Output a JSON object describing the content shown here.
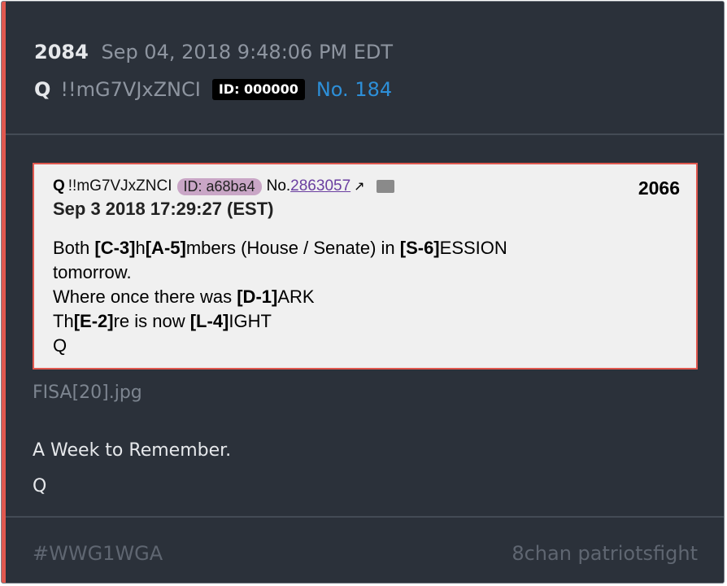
{
  "header": {
    "post_number": "2084",
    "date": "Sep 04, 2018 9:48:06 PM EDT",
    "author": "Q",
    "tripcode": "!!mG7VJxZNCI",
    "id_badge": "ID: 000000",
    "post_link": "No. 184"
  },
  "quoted_image": {
    "author": "Q",
    "tripcode": "!!mG7VJxZNCI",
    "id": "ID: a68ba4",
    "no_label": "No.",
    "no_link": "2863057",
    "ext_icon": "external-link-icon",
    "folder_icon": "folder-icon",
    "number": "2066",
    "date": "Sep 3 2018 17:29:27 (EST)",
    "line1_a": "Both ",
    "line1_b": "[C-3]",
    "line1_c": "h",
    "line1_d": "[A-5]",
    "line1_e": "mbers (House / Senate) in ",
    "line1_f": "[S-6]",
    "line1_g": "ESSION",
    "line2": "tomorrow.",
    "line3_a": "Where once there was ",
    "line3_b": "[D-1]",
    "line3_c": "ARK",
    "line4_a": "Th",
    "line4_b": "[E-2]",
    "line4_c": "re is now ",
    "line4_d": "[L-4]",
    "line4_e": "IGHT",
    "line5": "Q"
  },
  "attachment": {
    "filename": "FISA[20].jpg"
  },
  "message": {
    "line1": "A Week to Remember.",
    "line2": "Q"
  },
  "footer": {
    "tag": "#WWG1WGA",
    "source": "8chan patriotsfight"
  },
  "colors": {
    "accent": "#e0584f",
    "link": "#2d8fd8",
    "background": "#2b313a"
  }
}
